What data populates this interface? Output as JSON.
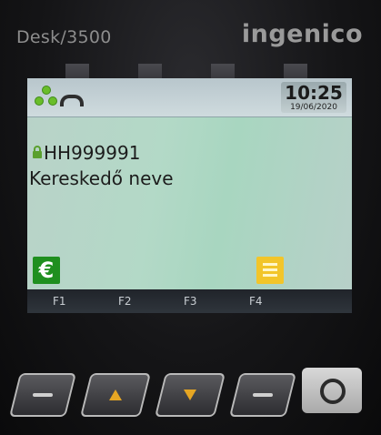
{
  "device": {
    "model": "Desk/3500",
    "brand": "ingenico"
  },
  "status_bar": {
    "icons": [
      "network-dots-icon",
      "phone-handset-icon"
    ],
    "time": "10:25",
    "date": "19/06/2020"
  },
  "merchant": {
    "terminal_id": "HH999991",
    "name": "Kereskedő neve",
    "lock_icon": "padlock-icon"
  },
  "softkeys": {
    "euro_symbol": "€",
    "euro_color": "#1f8f1f",
    "menu_icon": "list-menu-icon",
    "menu_color": "#f2c52a"
  },
  "fkeys": [
    "F1",
    "F2",
    "F3",
    "F4"
  ],
  "keypad": {
    "keys": [
      "dash-left-icon",
      "arrow-up-icon",
      "arrow-down-icon",
      "dash-right-icon",
      "ok-circle-icon"
    ]
  }
}
